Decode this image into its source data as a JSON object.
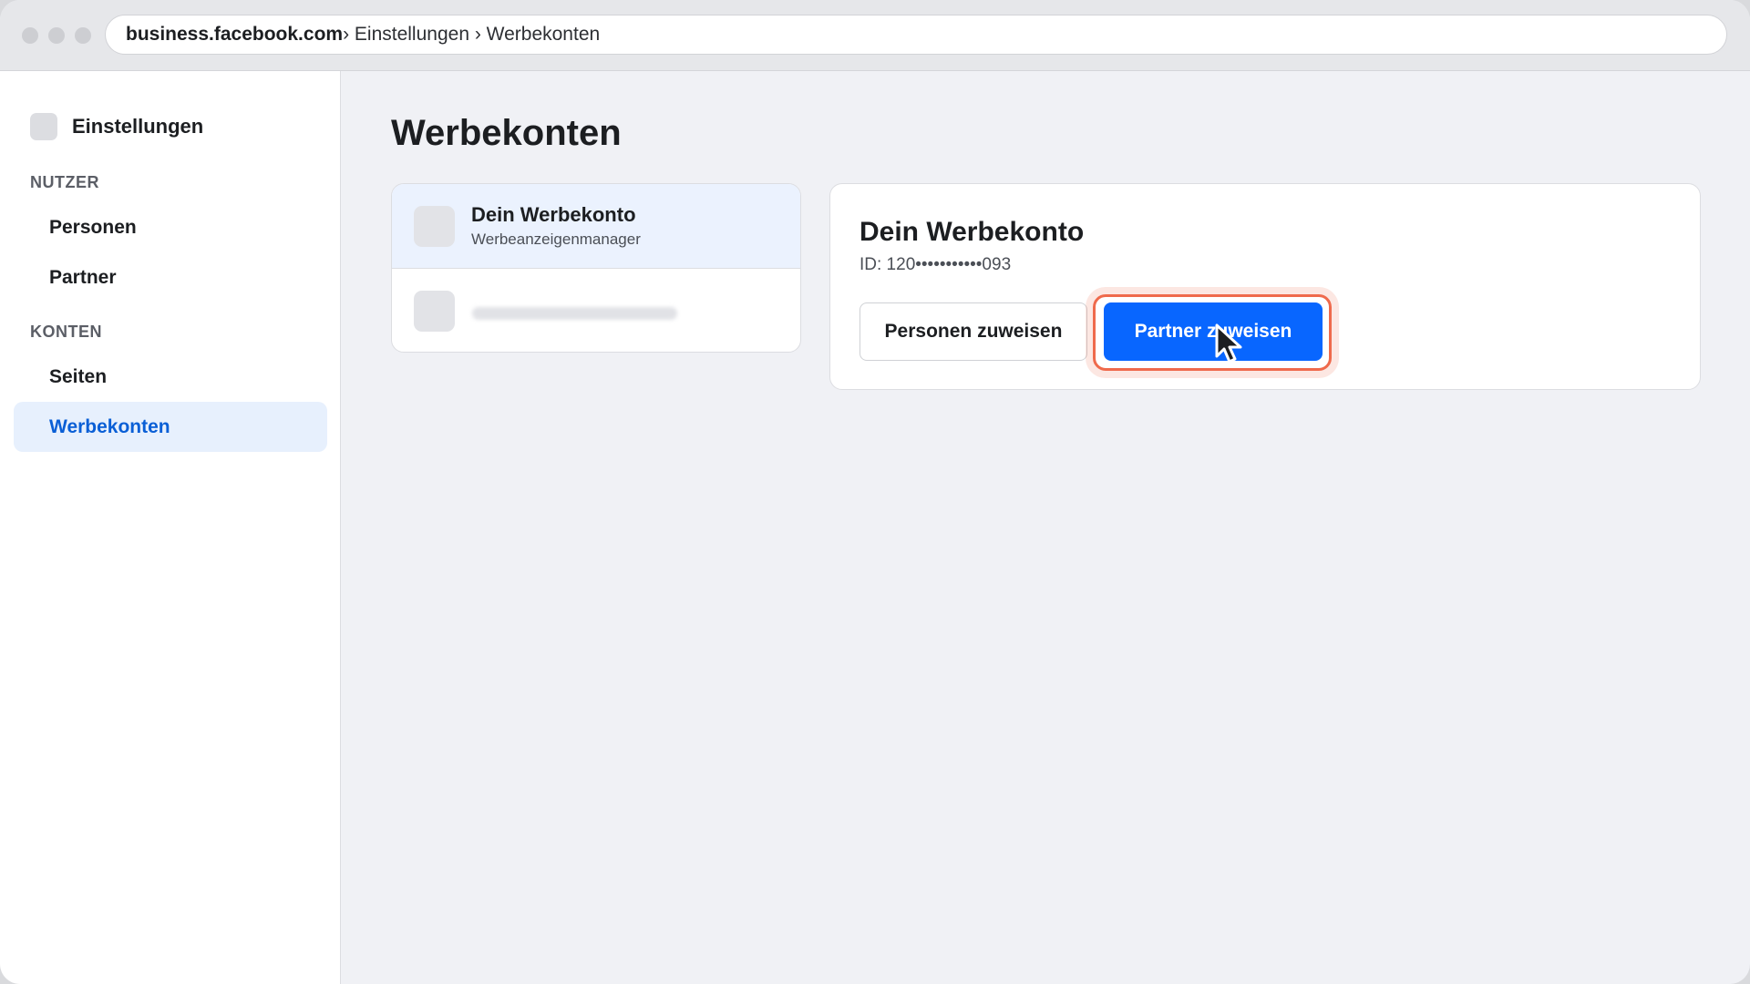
{
  "browser": {
    "domain": "business.facebook.com",
    "path": "› Einstellungen › Werbekonten"
  },
  "sidebar": {
    "title": "Einstellungen",
    "sections": [
      {
        "label": "NUTZER",
        "items": [
          {
            "label": "Personen",
            "active": false
          },
          {
            "label": "Partner",
            "active": false
          }
        ]
      },
      {
        "label": "KONTEN",
        "items": [
          {
            "label": "Seiten",
            "active": false
          },
          {
            "label": "Werbekonten",
            "active": true
          }
        ]
      }
    ]
  },
  "main": {
    "title": "Werbekonten",
    "accounts": [
      {
        "name": "Dein Werbekonto",
        "subtitle": "Werbeanzeigenmanager",
        "selected": true
      }
    ],
    "detail": {
      "name": "Dein Werbekonto",
      "id_text": "ID: 120•••••••••••093",
      "secondary_button": "Personen zuweisen",
      "primary_button": "Partner zuweisen"
    }
  },
  "colors": {
    "accent": "#0866ff",
    "active_nav_text": "#0a5fd6",
    "active_nav_bg": "#e7f0fd",
    "highlight_ring": "#ef6a4c"
  },
  "icons": {
    "cursor": "mouse-pointer-icon"
  }
}
